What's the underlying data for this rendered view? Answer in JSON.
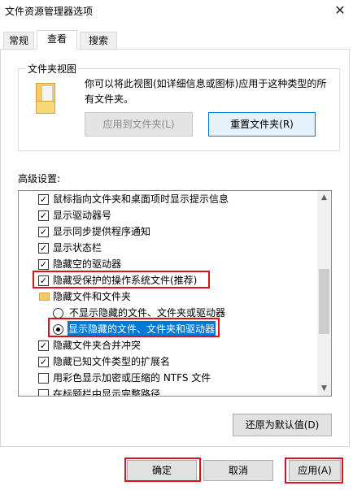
{
  "window": {
    "title": "文件资源管理器选项",
    "close_glyph": "✕"
  },
  "tabs": [
    {
      "label": "常规"
    },
    {
      "label": "查看"
    },
    {
      "label": "搜索"
    }
  ],
  "folder_view": {
    "group_title": "文件夹视图",
    "description": "你可以将此视图(如详细信息或图标)应用于这种类型的所有文件夹。",
    "apply_button": "应用到文件夹(L)",
    "reset_button": "重置文件夹(R)",
    "icon": "folder-icon"
  },
  "advanced": {
    "label": "高级设置:",
    "items": [
      {
        "type": "checkbox",
        "checked": true,
        "label": "鼠标指向文件夹和桌面项时显示提示信息"
      },
      {
        "type": "checkbox",
        "checked": true,
        "label": "显示驱动器号"
      },
      {
        "type": "checkbox",
        "checked": true,
        "label": "显示同步提供程序通知"
      },
      {
        "type": "checkbox",
        "checked": true,
        "label": "显示状态栏"
      },
      {
        "type": "checkbox",
        "checked": true,
        "label": "隐藏空的驱动器"
      },
      {
        "type": "checkbox",
        "checked": true,
        "label": "隐藏受保护的操作系统文件(推荐)"
      },
      {
        "type": "group",
        "label": "隐藏文件和文件夹"
      },
      {
        "type": "radio",
        "checked": false,
        "label": "不显示隐藏的文件、文件夹或驱动器"
      },
      {
        "type": "radio",
        "checked": true,
        "label": "显示隐藏的文件、文件夹和驱动器"
      },
      {
        "type": "checkbox",
        "checked": true,
        "label": "隐藏文件夹合并冲突"
      },
      {
        "type": "checkbox",
        "checked": true,
        "label": "隐藏已知文件类型的扩展名"
      },
      {
        "type": "checkbox",
        "checked": false,
        "label": "用彩色显示加密或压缩的 NTFS 文件"
      },
      {
        "type": "checkbox",
        "checked": false,
        "label": "在标题栏中显示完整路径"
      }
    ],
    "check_glyph": "✓",
    "scroll_up_glyph": "▲",
    "scroll_down_glyph": "▼"
  },
  "restore_button": "还原为默认值(D)",
  "footer": {
    "ok": "确定",
    "cancel": "取消",
    "apply": "应用(A)"
  },
  "colors": {
    "highlight": "#0078d7",
    "annotation_red": "#e0101a"
  }
}
